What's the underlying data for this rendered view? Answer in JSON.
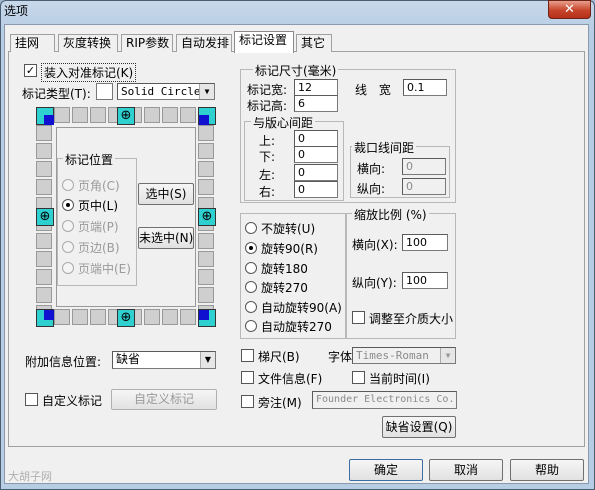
{
  "window": {
    "title": "选项",
    "close_glyph": "✕"
  },
  "tabs": [
    {
      "label": "挂网"
    },
    {
      "label": "灰度转换"
    },
    {
      "label": "RIP参数"
    },
    {
      "label": "自动发排"
    },
    {
      "label": "标记设置",
      "active": true
    },
    {
      "label": "其它"
    }
  ],
  "marks": {
    "load_label": "装入对准标记(K)",
    "load_checked": true,
    "type_label": "标记类型(T):",
    "type_value": "Solid Circle",
    "position_group": "标记位置",
    "positions": [
      "页角(C)",
      "页中(L)",
      "页端(P)",
      "页边(B)",
      "页端中(E)"
    ],
    "selected_position": "页中(L)",
    "select_btn": "选中(S)",
    "unselect_btn": "未选中(N)",
    "extra_info_label": "附加信息位置:",
    "extra_info_value": "缺省",
    "custom_label": "自定义标记",
    "custom_btn": "自定义标记"
  },
  "size": {
    "group": "标记尺寸(毫米)",
    "width_label": "标记宽:",
    "width_value": "12",
    "height_label": "标记高:",
    "height_value": "6",
    "line_label": "线 宽",
    "line_value": "0.1",
    "center_group": "与版心间距",
    "top_label": "上:",
    "top_value": "0",
    "bottom_label": "下:",
    "bottom_value": "0",
    "left_label": "左:",
    "left_value": "0",
    "right_label": "右:",
    "right_value": "0",
    "crop_group": "裁口线间距",
    "crop_h_label": "横向:",
    "crop_h_value": "0",
    "crop_v_label": "纵向:",
    "crop_v_value": "0"
  },
  "rotation": {
    "options": [
      "不旋转(U)",
      "旋转90(R)",
      "旋转180",
      "旋转270",
      "自动旋转90(A)",
      "自动旋转270"
    ],
    "selected": "旋转90(R)"
  },
  "scale": {
    "group": "缩放比例 (%)",
    "h_label": "横向(X):",
    "h_value": "100",
    "v_label": "纵向(Y):",
    "v_value": "100",
    "fit_label": "调整至介质大小"
  },
  "misc": {
    "ruler_label": "梯尺(B)",
    "font_label": "字体",
    "font_value": "Times-Roman",
    "fileinfo_label": "文件信息(F)",
    "curtime_label": "当前时间(I)",
    "note_label": "旁注(M)",
    "note_value": "Founder Electronics Co.,",
    "default_btn": "缺省设置(Q)"
  },
  "footer": {
    "ok": "确定",
    "cancel": "取消",
    "help": "帮助"
  },
  "watermark": "大胡子网"
}
